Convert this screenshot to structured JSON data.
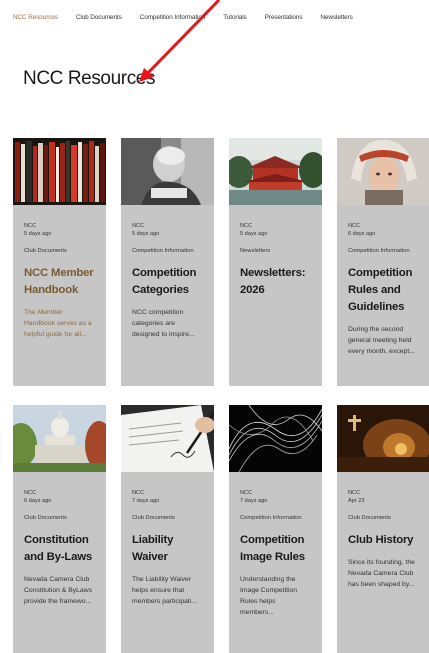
{
  "nav": {
    "items": [
      {
        "label": "NCC Resources",
        "active": true
      },
      {
        "label": "Club Documents",
        "active": false
      },
      {
        "label": "Competition Information",
        "active": false
      },
      {
        "label": "Tutorials",
        "active": false
      },
      {
        "label": "Presentations",
        "active": false
      },
      {
        "label": "Newsletters",
        "active": false
      }
    ]
  },
  "page": {
    "title": "NCC Resources"
  },
  "annotation": {
    "arrow_color": "#e8141c"
  },
  "colors": {
    "accent": "#a0733b",
    "card_bg": "#c6c6c6"
  },
  "cards": [
    {
      "author": "NCC",
      "date": "5 days ago",
      "category": "Club Documents",
      "title": "NCC Member Handbook",
      "excerpt": "The Member Handbook serves as a helpful guide for all...",
      "image": "bookshelf-photo"
    },
    {
      "author": "NCC",
      "date": "5 days ago",
      "category": "Competition Information",
      "title": "Competition Categories",
      "excerpt": "NCC competition categories are designed to inspire...",
      "image": "elderly-man-photo"
    },
    {
      "author": "NCC",
      "date": "5 days ago",
      "category": "Newsletters",
      "title": "Newsletters: 2026",
      "excerpt": "",
      "image": "red-temple-photo"
    },
    {
      "author": "NCC",
      "date": "6 days ago",
      "category": "Competition Information",
      "title": "Competition Rules and Guidelines",
      "excerpt": "During the second general meeting held every month, except...",
      "image": "child-headdress-photo"
    },
    {
      "author": "NCC",
      "date": "6 days ago",
      "category": "Club Documents",
      "title": "Constitution and By-Laws",
      "excerpt": "Nevada Camera Club Constitution & ByLaws provide the framewo...",
      "image": "capitol-building-photo"
    },
    {
      "author": "NCC",
      "date": "7 days ago",
      "category": "Club Documents",
      "title": "Liability Waiver",
      "excerpt": "The Liability Waiver helps ensure that members participati...",
      "image": "signing-document-photo"
    },
    {
      "author": "NCC",
      "date": "7 days ago",
      "category": "Competition Information",
      "title": "Competition Image Rules",
      "excerpt": "Understanding the Image Competition Rules helps members...",
      "image": "abstract-lines-photo"
    },
    {
      "author": "NCC",
      "date": "Apr 23",
      "category": "Club Documents",
      "title": "Club History",
      "excerpt": "Since its founding, the Nevada Camera Club has been shaped by...",
      "image": "candlelit-room-photo"
    }
  ]
}
